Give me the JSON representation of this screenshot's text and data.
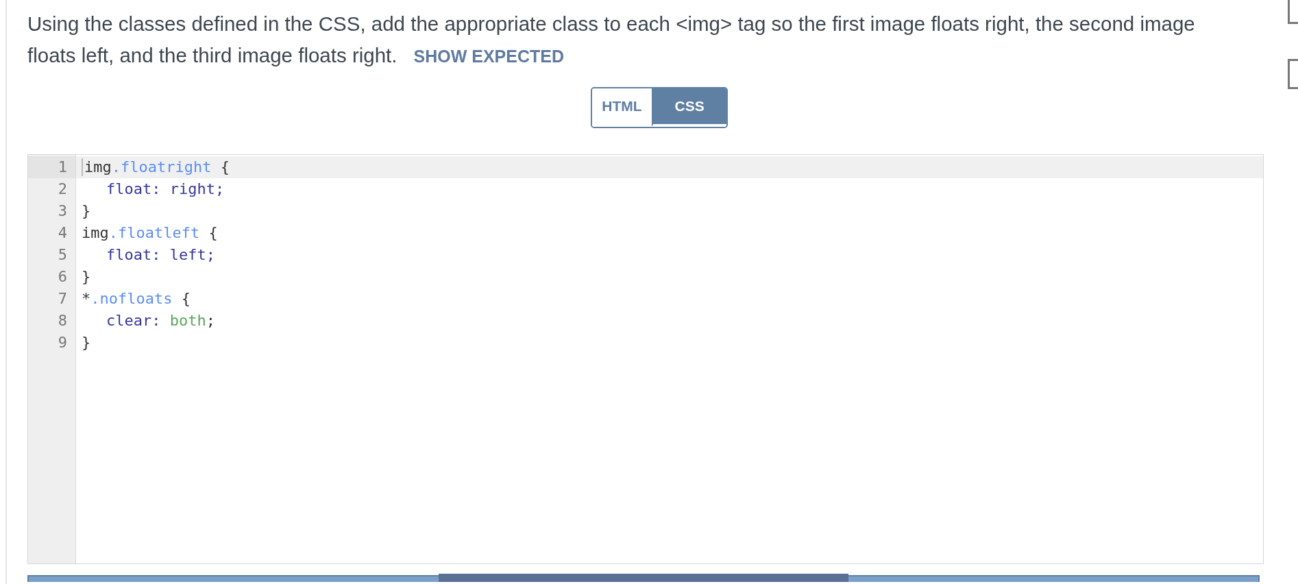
{
  "prompt": {
    "text": "Using the classes defined in the CSS, add the appropriate class to each <img> tag so the first image floats right, the second image floats left, and the third image floats right.",
    "link": "SHOW EXPECTED"
  },
  "tabs": [
    {
      "label": "HTML",
      "selected": false
    },
    {
      "label": "CSS",
      "selected": true
    }
  ],
  "editor": {
    "lines": [
      {
        "number": "1",
        "active": true,
        "indent": false,
        "tokens": [
          {
            "text": "img",
            "kind": "plain"
          },
          {
            "text": ".floatright",
            "kind": "class"
          },
          {
            "text": " {",
            "kind": "plain"
          }
        ]
      },
      {
        "number": "2",
        "active": false,
        "indent": true,
        "tokens": [
          {
            "text": "float:",
            "kind": "property"
          },
          {
            "text": " right;",
            "kind": "property"
          }
        ]
      },
      {
        "number": "3",
        "active": false,
        "indent": false,
        "tokens": [
          {
            "text": "}",
            "kind": "plain"
          }
        ]
      },
      {
        "number": "4",
        "active": false,
        "indent": false,
        "tokens": [
          {
            "text": "img",
            "kind": "plain"
          },
          {
            "text": ".floatleft",
            "kind": "class"
          },
          {
            "text": " {",
            "kind": "plain"
          }
        ]
      },
      {
        "number": "5",
        "active": false,
        "indent": true,
        "tokens": [
          {
            "text": "float:",
            "kind": "property"
          },
          {
            "text": " left;",
            "kind": "property"
          }
        ]
      },
      {
        "number": "6",
        "active": false,
        "indent": false,
        "tokens": [
          {
            "text": "}",
            "kind": "plain"
          }
        ]
      },
      {
        "number": "7",
        "active": false,
        "indent": false,
        "tokens": [
          {
            "text": "*",
            "kind": "plain"
          },
          {
            "text": ".nofloats",
            "kind": "class"
          },
          {
            "text": " {",
            "kind": "plain"
          }
        ]
      },
      {
        "number": "8",
        "active": false,
        "indent": true,
        "tokens": [
          {
            "text": "clear:",
            "kind": "property"
          },
          {
            "text": " both",
            "kind": "atom"
          },
          {
            "text": ";",
            "kind": "plain"
          }
        ]
      },
      {
        "number": "9",
        "active": false,
        "indent": false,
        "tokens": [
          {
            "text": "}",
            "kind": "plain"
          }
        ]
      }
    ]
  }
}
